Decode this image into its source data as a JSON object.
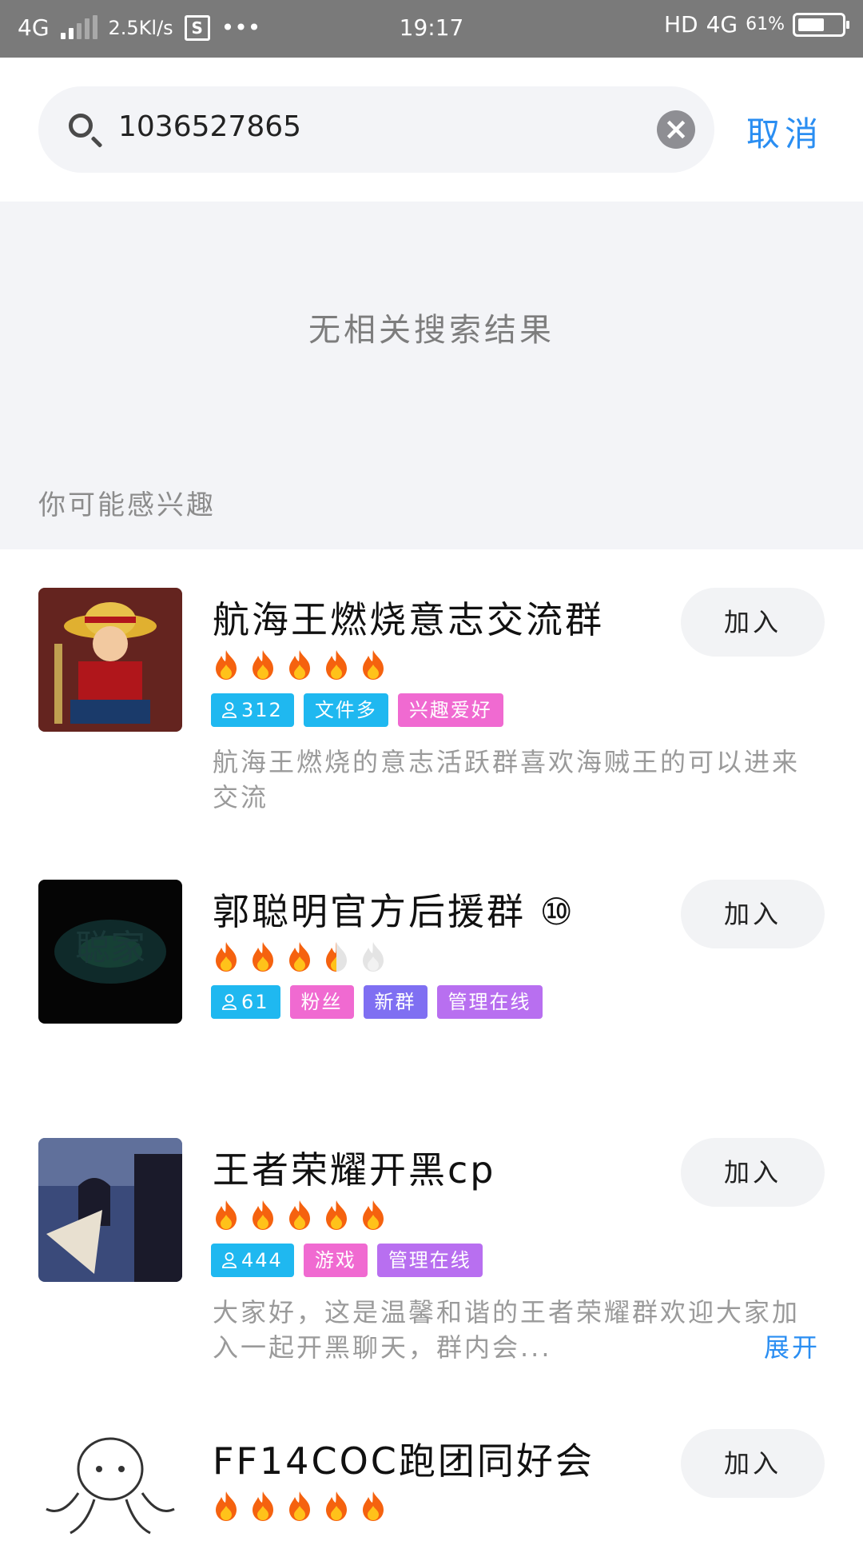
{
  "status_bar": {
    "network": "4G",
    "speed": "2.5Kl/s",
    "app_icon": "S",
    "dots": "•••",
    "time": "19:17",
    "hd": "HD",
    "network_right": "4G",
    "battery": "61%",
    "battery_level": 0.61
  },
  "search": {
    "value": "1036527865",
    "cancel_label": "取消"
  },
  "empty_message": "无相关搜索结果",
  "section_title": "你可能感兴趣",
  "groups": [
    {
      "name": "航海王燃烧意志交流群",
      "rating": 5,
      "members": "312",
      "tags": [
        {
          "label": "文件多",
          "color": "#1fb8f0"
        },
        {
          "label": "兴趣爱好",
          "color": "#f06ad1"
        }
      ],
      "description": "航海王燃烧的意志活跃群喜欢海贼王的可以进来交流",
      "join_label": "加入",
      "avatar_colors": [
        "#b0161b",
        "#d8a32a",
        "#2a1a1a"
      ]
    },
    {
      "name": "郭聪明官方后援群 ⑩",
      "rating": 3.5,
      "members": "61",
      "tags": [
        {
          "label": "粉丝",
          "color": "#f06ad1"
        },
        {
          "label": "新群",
          "color": "#7f6ff2"
        },
        {
          "label": "管理在线",
          "color": "#b86ff0"
        }
      ],
      "description": "",
      "join_label": "加入",
      "avatar_colors": [
        "#050505",
        "#0f2a2a",
        "#1a4a3a"
      ]
    },
    {
      "name": "王者荣耀开黑cp",
      "rating": 5,
      "members": "444",
      "tags": [
        {
          "label": "游戏",
          "color": "#f06ad1"
        },
        {
          "label": "管理在线",
          "color": "#b86ff0"
        }
      ],
      "description": "大家好，这是温馨和谐的王者荣耀群欢迎大家加入一起开黑聊天，群内会...",
      "expand_label": "展开",
      "join_label": "加入",
      "avatar_colors": [
        "#3a4a7a",
        "#7a8ab0",
        "#1a1a2a"
      ]
    },
    {
      "name": "FF14COC跑团同好会",
      "rating": 5,
      "members": "",
      "tags": [],
      "description": "",
      "join_label": "加入",
      "avatar_colors": [
        "#ffffff",
        "#333333",
        "#cccccc"
      ]
    }
  ]
}
